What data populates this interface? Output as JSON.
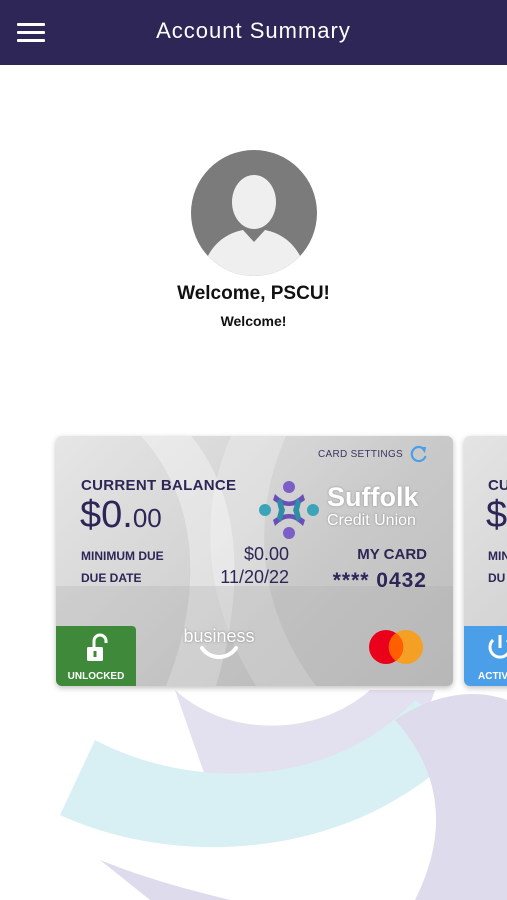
{
  "header": {
    "title": "Account Summary",
    "menu_icon": "hamburger-menu-icon"
  },
  "profile": {
    "welcome_title": "Welcome, PSCU!",
    "welcome_sub": "Welcome!"
  },
  "card": {
    "settings_label": "CARD SETTINGS",
    "current_balance_label": "CURRENT BALANCE",
    "balance_main": "$0.",
    "balance_cents": "00",
    "minimum_due_label": "MINIMUM DUE",
    "minimum_due_value": "$0.00",
    "due_date_label": "DUE DATE",
    "due_date_value": "11/20/22",
    "brand_name": "Suffolk",
    "brand_sub": "Credit Union",
    "my_card_label": "MY CARD",
    "card_number": "**** 0432",
    "business_label": "business",
    "lock_status": "UNLOCKED",
    "network": "mastercard"
  },
  "card2": {
    "balance_label_partial": "CU",
    "balance_partial": "$",
    "minimum_partial": "MIN",
    "due_partial": "DU",
    "status_partial": "ACTIV"
  },
  "colors": {
    "header_bg": "#2d2656",
    "card_text": "#2d2656",
    "unlocked_green": "#3e8a3a",
    "active_blue": "#4a9fe8",
    "settings_icon_blue": "#4a9fe8",
    "deco_purple": "#d9d6ea",
    "deco_cyan": "#d7eff3"
  }
}
